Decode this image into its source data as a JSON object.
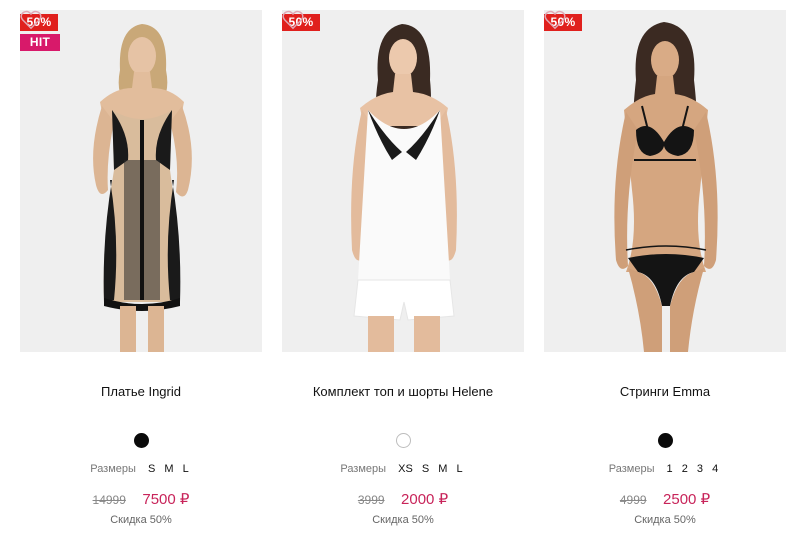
{
  "colors": {
    "sale_badge": "#e0201d",
    "hit_badge": "#d8196a",
    "price": "#c8245a"
  },
  "sizes_label": "Размеры",
  "products": [
    {
      "name": "Платье Ingrid",
      "sale_badge": "50%",
      "hit_badge": "HIT",
      "color": "black",
      "sizes": [
        "S",
        "M",
        "L"
      ],
      "old_price": "14999",
      "new_price": "7500 ₽",
      "discount": "Скидка 50%"
    },
    {
      "name": "Комплект топ и шорты Helene",
      "sale_badge": "50%",
      "color": "white",
      "sizes": [
        "XS",
        "S",
        "M",
        "L"
      ],
      "old_price": "3999",
      "new_price": "2000 ₽",
      "discount": "Скидка 50%"
    },
    {
      "name": "Стринги Emma",
      "sale_badge": "50%",
      "color": "black",
      "sizes": [
        "1",
        "2",
        "3",
        "4"
      ],
      "old_price": "4999",
      "new_price": "2500 ₽",
      "discount": "Скидка 50%"
    }
  ]
}
